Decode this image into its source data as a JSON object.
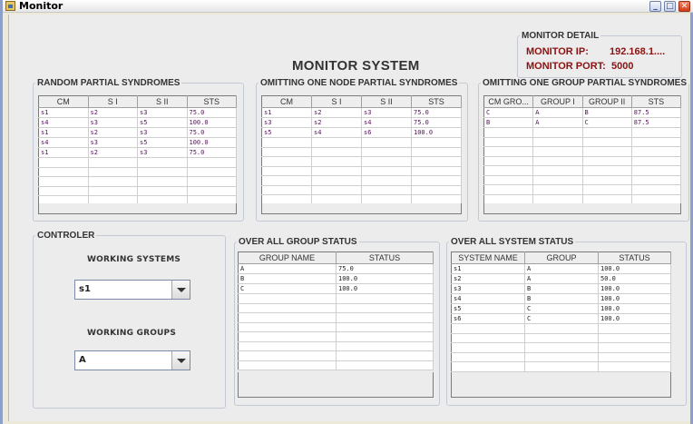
{
  "window": {
    "title": "Monitor"
  },
  "page_title": "MONITOR SYSTEM",
  "monitor_detail": {
    "legend": "MONITOR DETAIL",
    "ip_label": "MONITOR IP:",
    "ip_value": "192.168.1....",
    "port_label": "MONITOR PORT:",
    "port_value": "5000"
  },
  "random": {
    "legend": "RANDOM PARTIAL SYNDROMES",
    "columns": [
      "CM",
      "S I",
      "S II",
      "STS"
    ],
    "rows": [
      [
        "s1",
        "s2",
        "s3",
        "75.0"
      ],
      [
        "s4",
        "s3",
        "s5",
        "100.0"
      ],
      [
        "s1",
        "s2",
        "s3",
        "75.0"
      ],
      [
        "s4",
        "s3",
        "s5",
        "100.0"
      ],
      [
        "s1",
        "s2",
        "s3",
        "75.0"
      ]
    ]
  },
  "omit_node": {
    "legend": "OMITTING ONE NODE PARTIAL SYNDROMES",
    "columns": [
      "CM",
      "S I",
      "S II",
      "STS"
    ],
    "rows": [
      [
        "s1",
        "s2",
        "s3",
        "75.0"
      ],
      [
        "s3",
        "s2",
        "s4",
        "75.0"
      ],
      [
        "s5",
        "s4",
        "s6",
        "100.0"
      ]
    ]
  },
  "omit_group": {
    "legend": "OMITTING ONE GROUP PARTIAL SYNDROMES",
    "columns": [
      "CM GRO...",
      "GROUP I",
      "GROUP II",
      "STS"
    ],
    "rows": [
      [
        "C",
        "A",
        "B",
        "87.5"
      ],
      [
        "B",
        "A",
        "C",
        "87.5"
      ]
    ]
  },
  "controller": {
    "legend": "CONTROLER",
    "systems_label": "WORKING SYSTEMS",
    "systems_value": "s1",
    "groups_label": "WORKING GROUPS",
    "groups_value": "A"
  },
  "group_status": {
    "legend": "OVER ALL GROUP STATUS",
    "columns": [
      "GROUP NAME",
      "STATUS"
    ],
    "rows": [
      [
        "A",
        "75.0"
      ],
      [
        "B",
        "100.0"
      ],
      [
        "C",
        "100.0"
      ]
    ]
  },
  "system_status": {
    "legend": "OVER ALL SYSTEM STATUS",
    "columns": [
      "SYSTEM NAME",
      "GROUP",
      "STATUS"
    ],
    "rows": [
      [
        "s1",
        "A",
        "100.0"
      ],
      [
        "s2",
        "A",
        "50.0"
      ],
      [
        "s3",
        "B",
        "100.0"
      ],
      [
        "s4",
        "B",
        "100.0"
      ],
      [
        "s5",
        "C",
        "100.0"
      ],
      [
        "s6",
        "C",
        "100.0"
      ]
    ]
  }
}
